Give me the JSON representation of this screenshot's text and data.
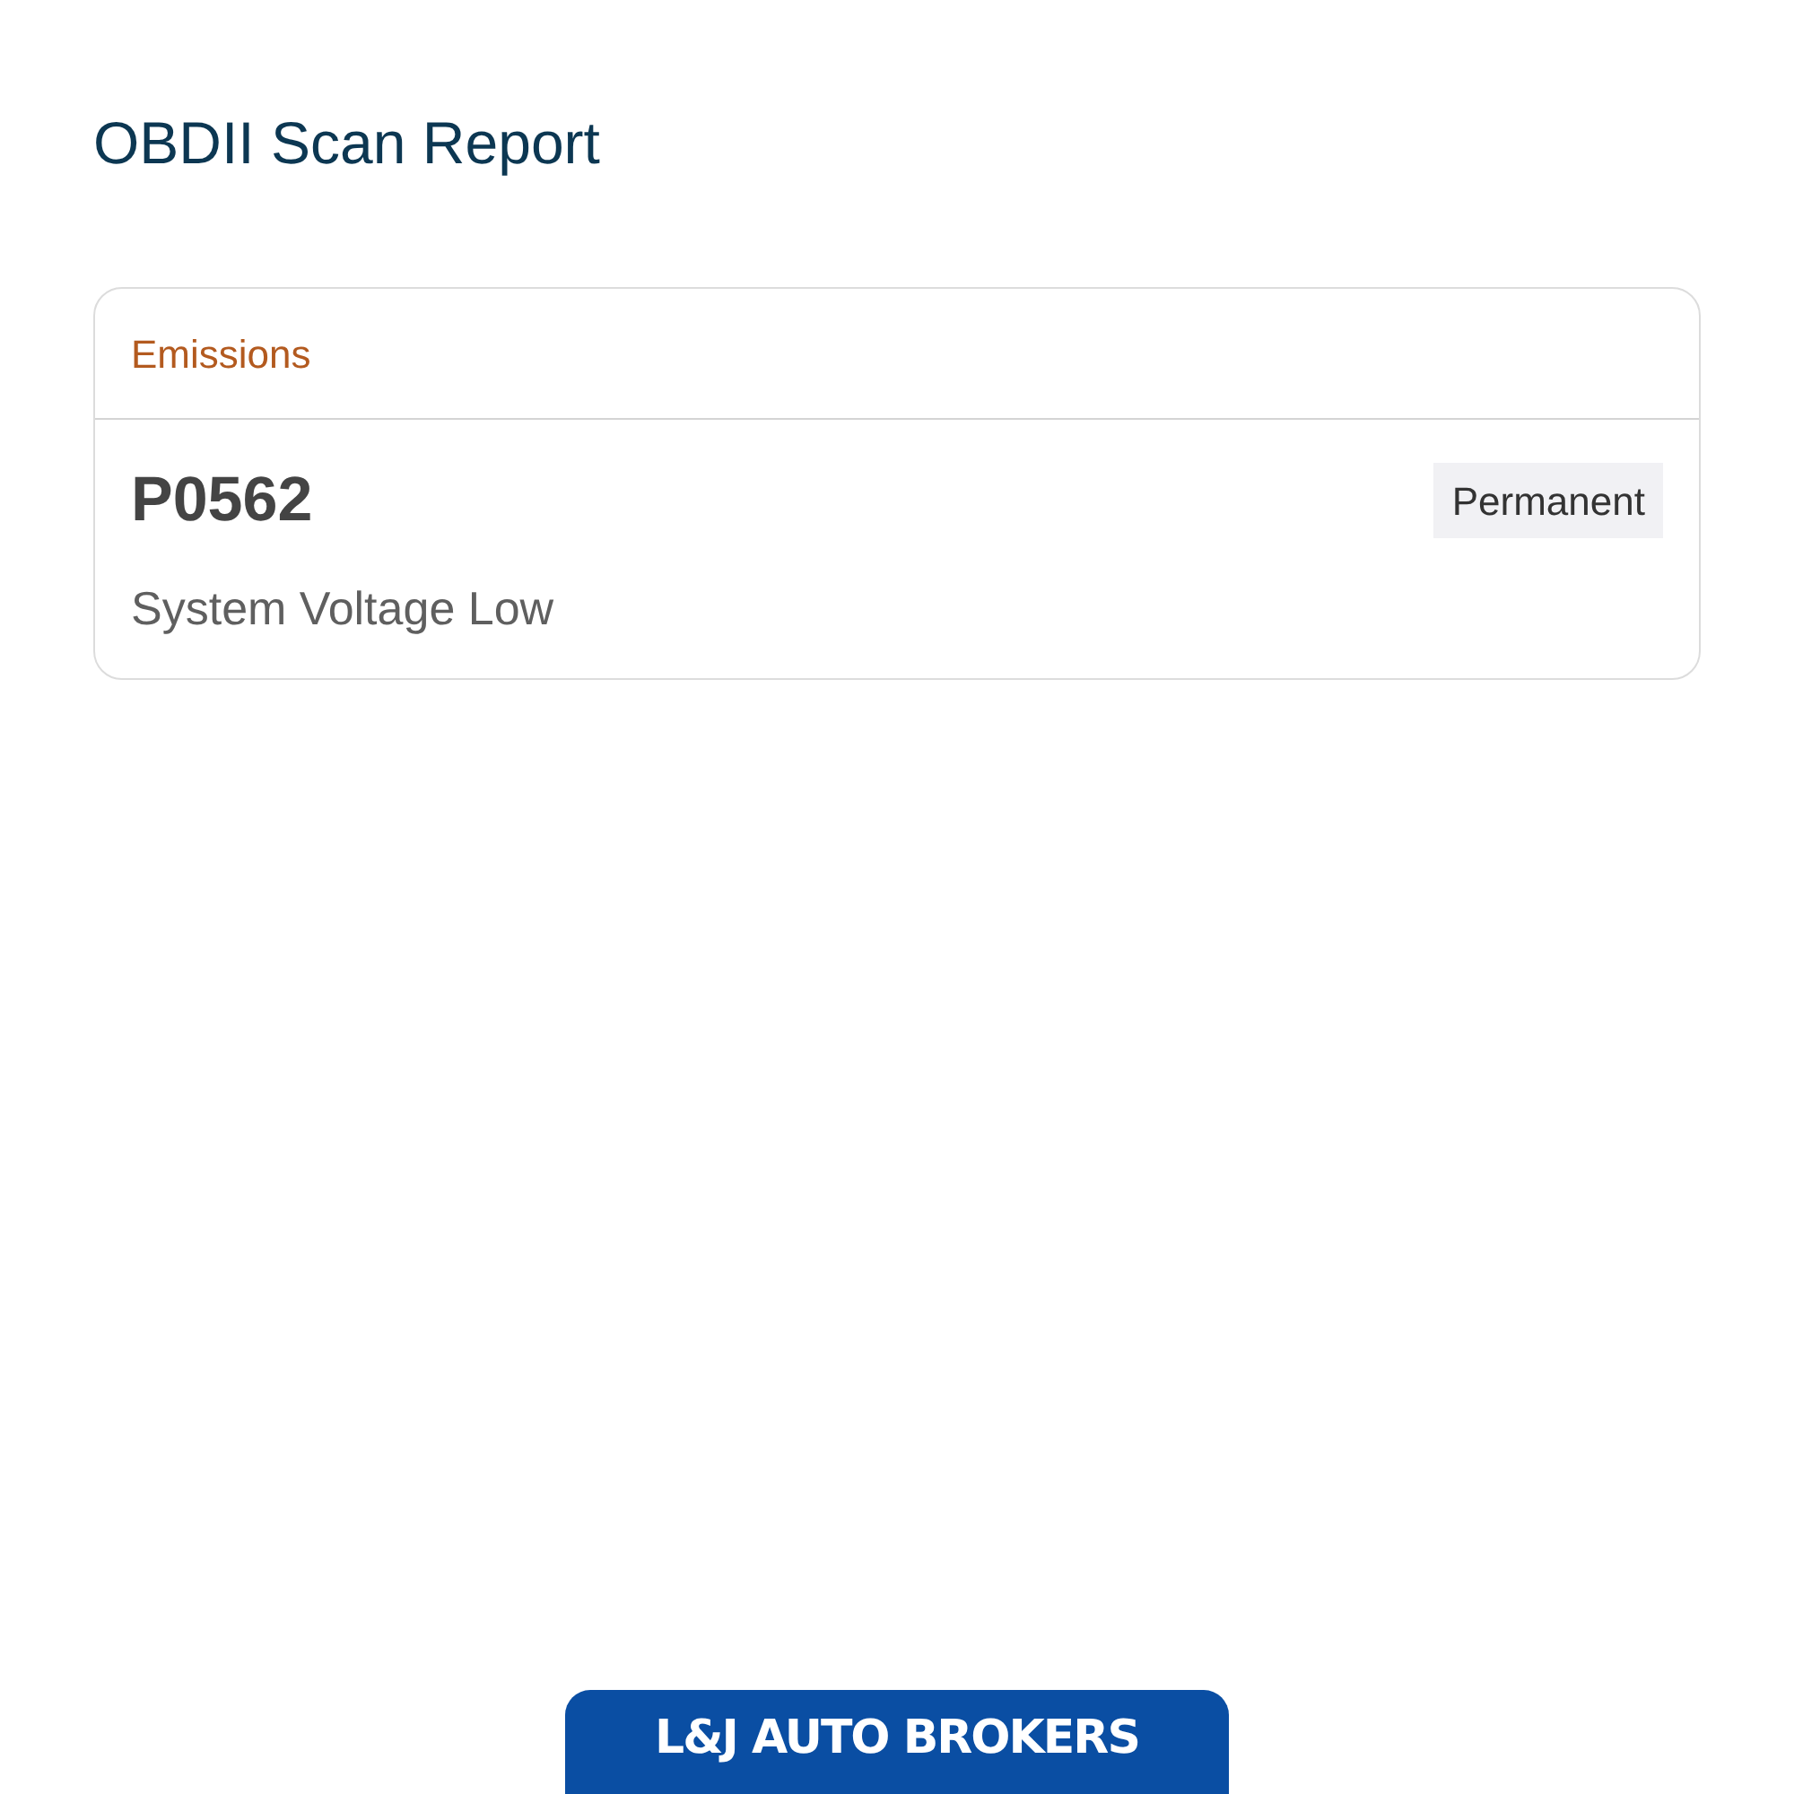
{
  "title": "OBDII Scan Report",
  "sections": [
    {
      "category": "Emissions",
      "codes": [
        {
          "code": "P0562",
          "status": "Permanent",
          "description": "System Voltage Low"
        }
      ]
    }
  ],
  "footer": {
    "logo_text": "L&J AUTO BROKERS"
  }
}
